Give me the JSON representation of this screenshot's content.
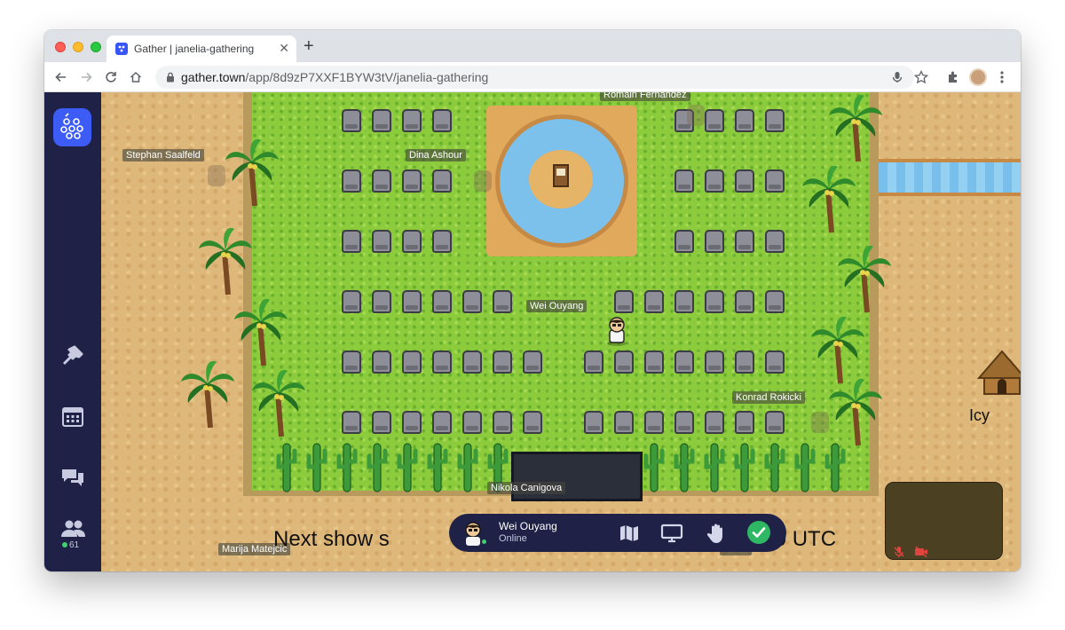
{
  "browser": {
    "tab_title": "Gather | janelia-gathering",
    "url_host": "gather.town",
    "url_path": "/app/8d9zP7XXF1BYW3tV/janelia-gathering",
    "close_tab_glyph": "✕",
    "new_tab_glyph": "+"
  },
  "sidebar": {
    "items": [
      {
        "icon": "hammer-icon"
      },
      {
        "icon": "calendar-icon"
      },
      {
        "icon": "chat-icon"
      },
      {
        "icon": "participants-icon"
      }
    ],
    "online_count": "61"
  },
  "map": {
    "name_tags": [
      {
        "id": "stephan",
        "label": "Stephan Saalfeld"
      },
      {
        "id": "dina",
        "label": "Dina Ashour"
      },
      {
        "id": "romain",
        "label": "Romain Fernandez"
      },
      {
        "id": "wei",
        "label": "Wei Ouyang"
      },
      {
        "id": "konrad",
        "label": "Konrad Rokicki"
      },
      {
        "id": "nikola",
        "label": "Nikola Canigova"
      },
      {
        "id": "marija",
        "label": "Marija Matejcic"
      },
      {
        "id": "moon",
        "label": "Moon"
      }
    ],
    "banner_left": "Next show s",
    "banner_right": "20:00 UTC",
    "hut_label": "Icy"
  },
  "control_bar": {
    "user_name": "Wei Ouyang",
    "status": "Online",
    "buttons": [
      "map-icon",
      "screen-share-icon",
      "raise-hand-icon",
      "checkmark-icon"
    ]
  },
  "colors": {
    "sidebar_bg": "#1f2246",
    "brand_blue": "#3d5cf5",
    "online_green": "#3fd06f",
    "grass": "#8ccc3c",
    "sand": "#deb77a"
  }
}
